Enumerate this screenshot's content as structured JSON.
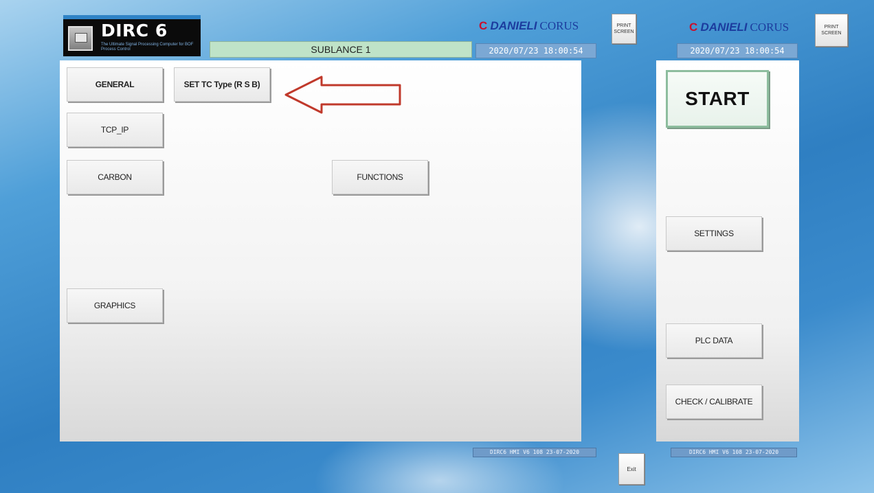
{
  "header": {
    "logo_title": "DIRC 6",
    "logo_subtitle": "The Ultimate Signal Processing Computer for BOF Process Control",
    "sublance_label": "SUBLANCE 1"
  },
  "brand": {
    "mark": "C",
    "name_bold": "DANIELI",
    "name_serif": "CORUS"
  },
  "datetime": "2020/07/23 18:00:54",
  "print_screen_label": "PRINT SCREEN",
  "left_panel": {
    "general": "GENERAL",
    "set_tc_type": "SET TC Type (R S B)",
    "tcp_ip": "TCP_IP",
    "carbon": "CARBON",
    "functions": "FUNCTIONS",
    "graphics": "GRAPHICS"
  },
  "right_panel": {
    "start": "START",
    "settings": "SETTINGS",
    "plc_data": "PLC DATA",
    "check_calibrate": "CHECK / CALIBRATE"
  },
  "version": "DIRC6 HMI V6 108 23-07-2020",
  "exit_label": "Exit",
  "colors": {
    "annotation_arrow": "#c0392b",
    "brand_blue": "#1c3c9e",
    "sublance_bar": "#bfe3c8"
  }
}
